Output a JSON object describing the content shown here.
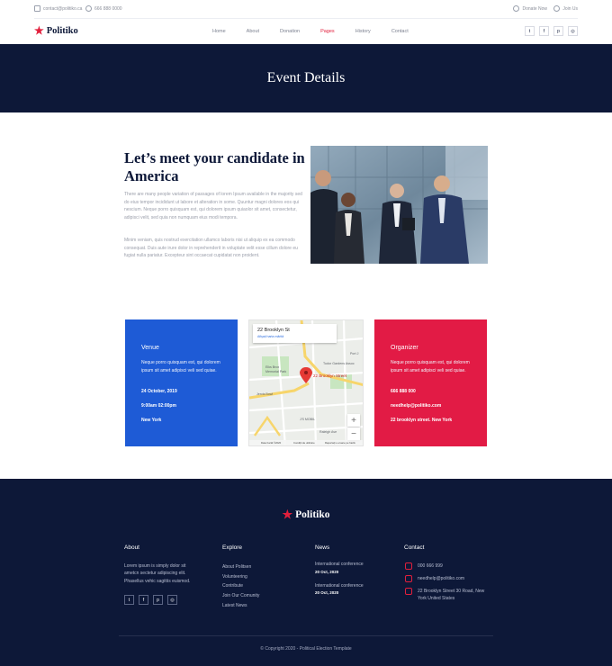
{
  "topbar": {
    "email": "contact@politiko.ca",
    "phone": "666 888 0000",
    "donate": "Donate Now",
    "join": "Join Us"
  },
  "nav": {
    "brand": "Politiko",
    "items": [
      "Home",
      "About",
      "Donation",
      "Pages",
      "History",
      "Contact"
    ],
    "active_index": 3,
    "socials": [
      "twitter-icon",
      "facebook-icon",
      "pinterest-icon",
      "instagram-icon"
    ]
  },
  "hero": {
    "title": "Event Details"
  },
  "intro": {
    "title": "Let’s meet your candidate in America",
    "p1": "There are many people variation of passages of lorem Ipsum available in the majority sed do eius tempor incididunt ut labore et alteration in some. Quuntur magni dolores eos qui nescium. Neque porro quisquam est, qui dolorem ipsum quiaolor sit amet, consectetur, adipisci velit, sed quia non numquam eius modi tempora.",
    "p2": "Minim veniam, quis nostrud exercitation ullamco laboris nisi ut aliquip ex ea commodo consequat. Duis aute irure dolor in reprehenderit in voluptate velit esse cillum dolore eu fugiat nulla pariatur. Excepteur sint occaecat cupidatat non proident."
  },
  "venue": {
    "title": "Venue",
    "desc": "Neque porro quisquam est, qui dolorem ipsum sit amet adipisci veli sed quiae.",
    "date": "24 October, 2019",
    "time": "9:00am 02:00pm",
    "place": "New York"
  },
  "map": {
    "address": "22 Brooklyn St",
    "link": "Afişați harta mărită",
    "pin": "22 Brooklyn Street",
    "labels": [
      "Port J",
      "Tudor Gardens Assoc",
      "Elks Brox Memorial Park",
      "Jervis Bowl",
      "J'S MOBIL",
      "Raleigh Ave"
    ],
    "footer": [
      "Date hartă ©2020",
      "Condiții de utilizare",
      "Raportați o eroare pe hartă"
    ],
    "zoom_in": "+",
    "zoom_out": "−"
  },
  "organizer": {
    "title": "Organizer",
    "desc": "Neque porro quisquam est, qui dolorem ipsum sit amet adipisci veli sed quiae.",
    "phone": "666 888 000",
    "email": "needhelp@politiko.com",
    "address": "22 brooklyn street. New York"
  },
  "footer": {
    "brand": "Politiko",
    "about_title": "About",
    "about_text": "Lorem ipsum is simply dolor sit ametcn sectetur adipiscing elit. Phasellus vehic sagittis euismod.",
    "explore_title": "Explore",
    "explore_links": [
      "About Politsen",
      "Volunteering",
      "Contribute",
      "Join Our Comunity",
      "Latest News"
    ],
    "news_title": "News",
    "news": [
      {
        "title": "International conference",
        "date": "20 Oct, 2020"
      },
      {
        "title": "International conference",
        "date": "20 Oct, 2020"
      }
    ],
    "contact_title": "Contact",
    "contact_phone": "000 666 999",
    "contact_email": "needhelp@politiko.com",
    "contact_address": "22 Brooklyn Street 30 Road, New York United States",
    "copyright": "© Copyright 2020 - Political Election Template"
  },
  "colors": {
    "navy": "#0d1838",
    "red": "#e21f3c",
    "blue": "#1e5bd6",
    "crimson": "#e21b45"
  }
}
